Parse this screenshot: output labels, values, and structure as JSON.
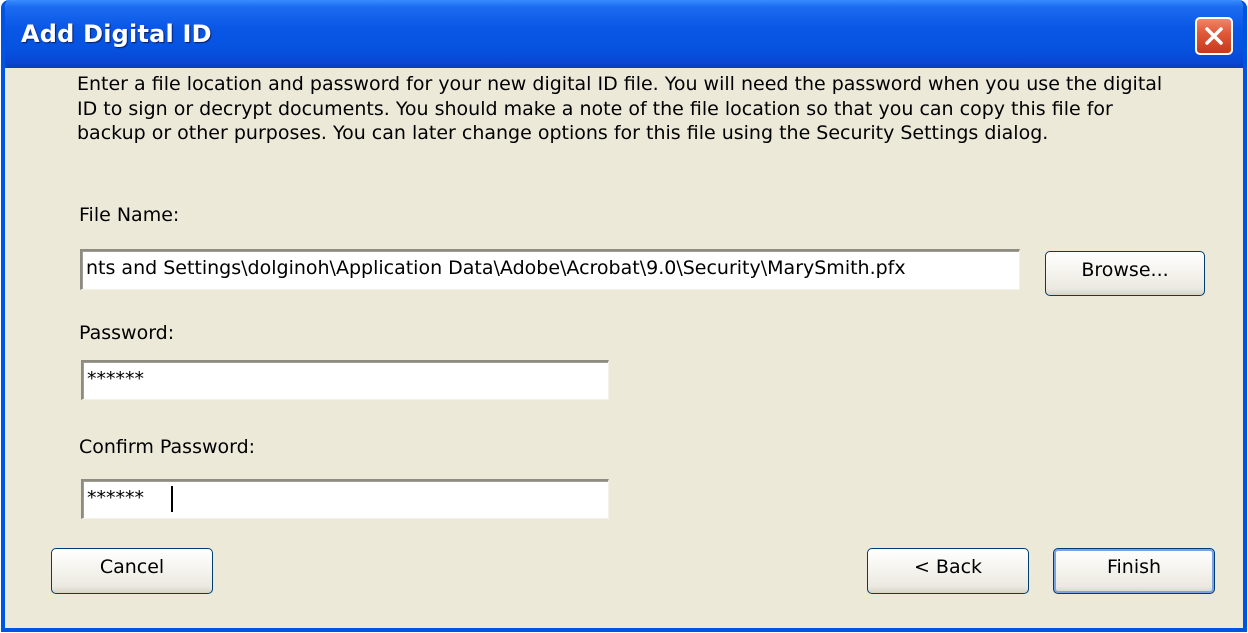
{
  "window": {
    "title": "Add Digital ID"
  },
  "description": "Enter a file location and password for your new digital ID file. You will need the password when you use the digital ID to sign or decrypt documents. You should make a note of the file location so that you can copy this file for backup or other purposes. You can later change options for this file using the Security Settings dialog.",
  "file_name": {
    "label": "File Name:",
    "value": "nts and Settings\\dolginoh\\Application Data\\Adobe\\Acrobat\\9.0\\Security\\MarySmith.pfx",
    "browse_label": "Browse..."
  },
  "password": {
    "label": "Password:",
    "value": "******"
  },
  "confirm_password": {
    "label": "Confirm Password:",
    "value": "******"
  },
  "buttons": {
    "cancel": "Cancel",
    "back": "< Back",
    "finish": "Finish"
  },
  "colors": {
    "titlebar": "#0653e0",
    "dialog_background": "#ece9d8",
    "close_button": "#e05a3a"
  },
  "icons": {
    "close": "close-x-icon"
  }
}
